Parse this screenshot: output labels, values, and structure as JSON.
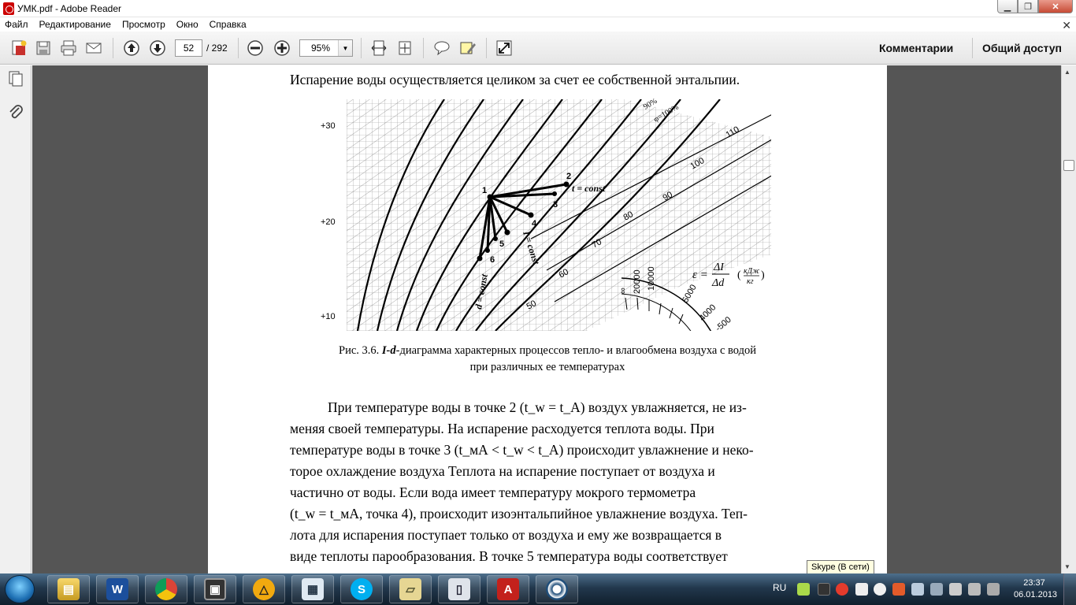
{
  "window": {
    "title": "УМК.pdf - Adobe Reader",
    "min_glyph": "▁",
    "max_glyph": "❐",
    "close_glyph": "✕"
  },
  "menu": {
    "items": [
      "Файл",
      "Редактирование",
      "Просмотр",
      "Окно",
      "Справка"
    ],
    "close_glyph": "✕"
  },
  "toolbar": {
    "page_current": "52",
    "page_total": "/ 292",
    "zoom": "95%",
    "comments_label": "Комментарии",
    "share_label": "Общий доступ"
  },
  "document": {
    "line_top": "Испарение воды осуществляется целиком за счет ее собственной энтальпии.",
    "caption_line1_prefix": "Рис. 3.6. ",
    "caption_line1_italic": "I-d",
    "caption_line1_rest": "-диаграмма характерных процессов тепло- и влагообмена воздуха с водой",
    "caption_line2": "при различных ее температурах",
    "paragraph": [
      "При температуре воды в точке 2 (t_w = t_A) воздух увлажняется, не из-",
      "меняя своей температуры. На испарение расходуется теплота воды. При",
      "температуре воды в точке 3 (t_мА < t_w < t_A) происходит увлажнение и неко-",
      "торое охлаждение воздуха Теплота на испарение поступает от воздуха и",
      "частично от воды. Если вода имеет температуру мокрого термометра",
      "(t_w = t_мА, точка 4), происходит изоэнтальпийное увлажнение воздуха. Теп-",
      "лота для испарения поступает только от воздуха и ему же возвращается в",
      "виде теплоты парообразования. В точке 5 температура воды соответствует"
    ]
  },
  "diagram": {
    "y_ticks": [
      "+30",
      "+20",
      "+10"
    ],
    "enthalpy_ticks": [
      "110",
      "100",
      "90",
      "80",
      "70",
      "60",
      "50"
    ],
    "epsilon_ticks": [
      "∞",
      "20000",
      "10000",
      "5000",
      "4000",
      "-500"
    ],
    "phi_labels": [
      "90%",
      "φ=100%"
    ],
    "point_labels": [
      "1",
      "2",
      "3",
      "4",
      "5",
      "6"
    ],
    "line_labels": [
      "t = const",
      "I = const",
      "d = const"
    ],
    "formula": "ε = ΔI/Δd (кДж/кг)",
    "formula_eps": "ε =",
    "formula_num": "ΔI",
    "formula_den": "Δd",
    "formula_unit_num": "кДж",
    "formula_unit_den": "кг"
  },
  "tooltip": "Skype (В сети)",
  "taskbar": {
    "apps": [
      "explorer",
      "word",
      "chrome",
      "save",
      "avast",
      "calculator",
      "skype",
      "folder",
      "phone",
      "acrobat",
      "target"
    ],
    "lang": "RU",
    "time": "23:37",
    "date": "06.01.2013"
  }
}
